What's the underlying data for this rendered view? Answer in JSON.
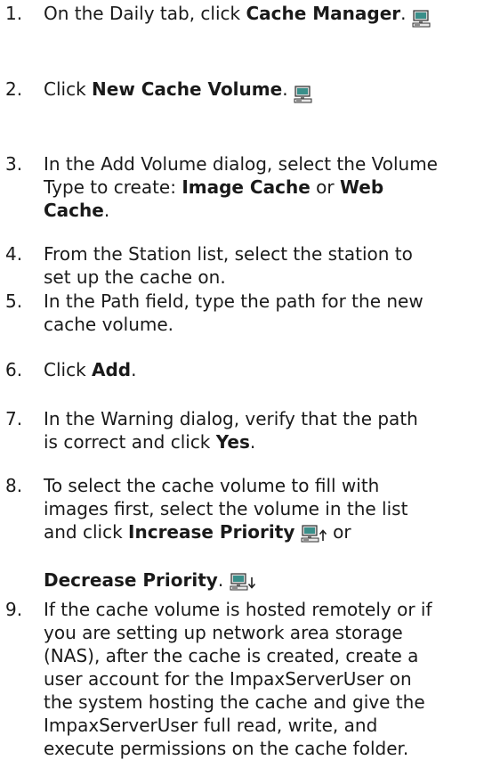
{
  "steps": [
    {
      "num": "1.",
      "lines": [
        [
          "On the Daily tab, click ",
          {
            "b": "Cache Manager"
          },
          ". ",
          {
            "icon": "computer-icon"
          }
        ]
      ]
    },
    {
      "num": "2.",
      "lines": [
        [
          "Click ",
          {
            "b": "New Cache Volume"
          },
          ". ",
          {
            "icon": "computer-icon"
          }
        ]
      ]
    },
    {
      "num": "3.",
      "lines": [
        [
          "In the Add Volume dialog, select the Volume"
        ],
        [
          "Type to create: ",
          {
            "b": "Image Cache"
          },
          " or ",
          {
            "b": "Web"
          }
        ],
        [
          {
            "b": "Cache"
          },
          "."
        ]
      ]
    },
    {
      "num": "4.",
      "lines": [
        [
          "From the Station list, select the station to"
        ],
        [
          "set up the cache on."
        ]
      ]
    },
    {
      "num": "5.",
      "lines": [
        [
          "In the Path field, type the path for the new"
        ],
        [
          "cache volume."
        ]
      ]
    },
    {
      "num": "6.",
      "lines": [
        [
          "Click ",
          {
            "b": "Add"
          },
          "."
        ]
      ]
    },
    {
      "num": "7.",
      "lines": [
        [
          "In the Warning dialog, verify that the path"
        ],
        [
          "is correct and click ",
          {
            "b": "Yes"
          },
          "."
        ]
      ]
    },
    {
      "num": "8.",
      "lines": [
        [
          "To select the cache volume to fill with"
        ],
        [
          "images first, select the volume in the list"
        ],
        [
          "and click ",
          {
            "b": "Increase Priority"
          },
          " ",
          {
            "icon": "increase-priority-icon"
          },
          " or"
        ],
        [],
        [
          {
            "b": "Decrease Priority"
          },
          ". ",
          {
            "icon": "decrease-priority-icon"
          }
        ]
      ]
    },
    {
      "num": "9.",
      "lines": [
        [
          "If the cache volume is hosted remotely or if"
        ],
        [
          "you are setting up network area storage"
        ],
        [
          "(NAS), after the cache is created, create a"
        ],
        [
          "user account for the ImpaxServerUser on"
        ],
        [
          "the system hosting the cache and give the"
        ],
        [
          "ImpaxServerUser full read, write, and"
        ],
        [
          "execute permissions on the cache folder."
        ]
      ]
    }
  ]
}
